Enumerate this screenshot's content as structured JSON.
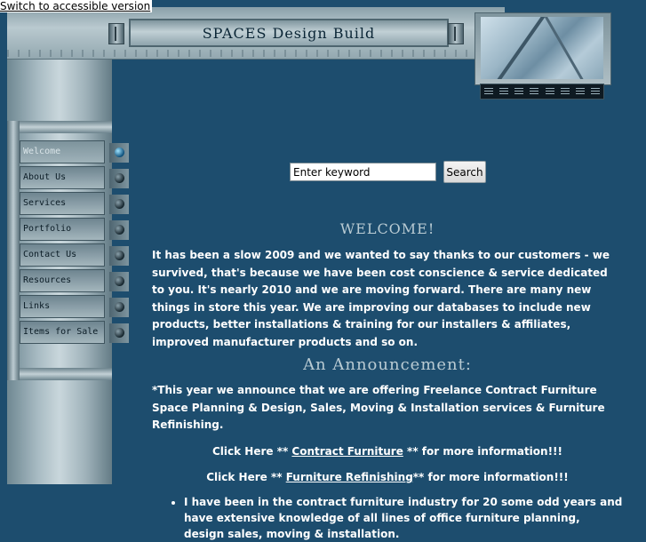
{
  "accessible_link": "Switch to accessible version",
  "header": {
    "title": "SPACES Design Build"
  },
  "nav": {
    "items": [
      {
        "label": "Welcome",
        "active": true
      },
      {
        "label": "About Us"
      },
      {
        "label": "Services"
      },
      {
        "label": "Portfolio"
      },
      {
        "label": "Contact Us"
      },
      {
        "label": "Resources"
      },
      {
        "label": "Links"
      },
      {
        "label": "Items for Sale"
      }
    ]
  },
  "search": {
    "value": "Enter keyword",
    "button": "Search"
  },
  "content": {
    "welcome_heading": "WELCOME!",
    "intro": "It has been a slow 2009 and we wanted to say thanks to our customers - we survived, that's because we have been cost conscience & service dedicated to you. It's nearly 2010 and we are moving forward. There are many new things in store this year. We are improving our databases to include new products, better installations & training for our installers & affiliates, improved manufacturer products and so on.",
    "announce_heading": "An Announcement:",
    "announce": "*This year we announce that we are offering Freelance Contract Furniture Space Planning & Design, Sales, Moving & Installation services & Furniture Refinishing.",
    "click1": {
      "pre": "Click Here **  ",
      "link": "Contract Furniture",
      "post": " ** for more information!!!"
    },
    "click2": {
      "pre": "Click Here **  ",
      "link": "Furniture Refinishing",
      "post": "** for more information!!!"
    },
    "bullet1": "I have been in the contract furniture industry for 20 some odd years and have extensive knowledge of all lines of office furniture planning, design sales, moving & installation."
  },
  "colors": {
    "background": "#1d4d6e",
    "heading": "#b9cbd3",
    "text": "#ffffff"
  }
}
